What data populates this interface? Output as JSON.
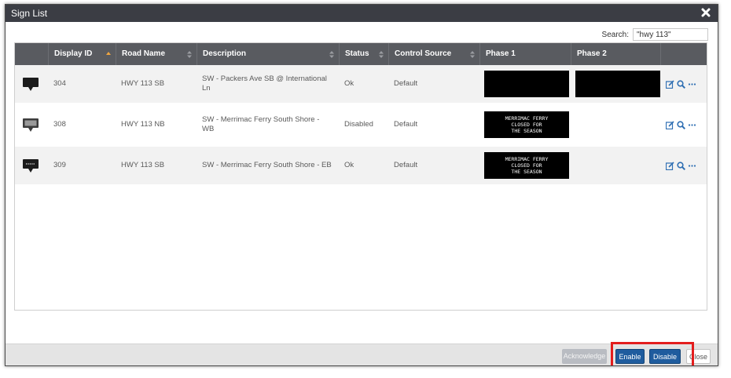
{
  "dialog": {
    "title": "Sign List"
  },
  "search": {
    "label": "Search:",
    "value": "\"hwy 113\""
  },
  "table": {
    "columns": [
      "",
      "Display ID",
      "Road Name",
      "Description",
      "Status",
      "Control Source",
      "Phase 1",
      "Phase 2",
      ""
    ],
    "rows": [
      {
        "display_id": "304",
        "road_name": "HWY 113 SB",
        "description": "SW - Packers Ave SB @ International Ln",
        "status": "Ok",
        "control_source": "Default",
        "sign_icon": "sign-dark-icon",
        "phase1": [
          "",
          "",
          ""
        ],
        "phase2": [
          "",
          "",
          ""
        ]
      },
      {
        "display_id": "308",
        "road_name": "HWY 113 NB",
        "description": "SW - Merrimac Ferry South Shore - WB",
        "status": "Disabled",
        "control_source": "Default",
        "sign_icon": "sign-disabled-icon",
        "phase1": [
          "MERRIMAC FERRY",
          "CLOSED FOR",
          "THE SEASON"
        ]
      },
      {
        "display_id": "309",
        "road_name": "HWY 113 SB",
        "description": "SW - Merrimac Ferry South Shore - EB",
        "status": "Ok",
        "control_source": "Default",
        "sign_icon": "sign-message-icon",
        "phase1": [
          "MERRIMAC FERRY",
          "CLOSED FOR",
          "THE SEASON"
        ]
      }
    ]
  },
  "footer": {
    "acknowledge_label": "Acknowledge",
    "enable_label": "Enable",
    "disable_label": "Disable",
    "close_label": "Close"
  },
  "colors": {
    "titlebar": "#3b3d44",
    "header": "#595b60",
    "primary_button": "#1f5c9e",
    "highlight": "#e31d1d",
    "sort_active": "#f0a640"
  }
}
